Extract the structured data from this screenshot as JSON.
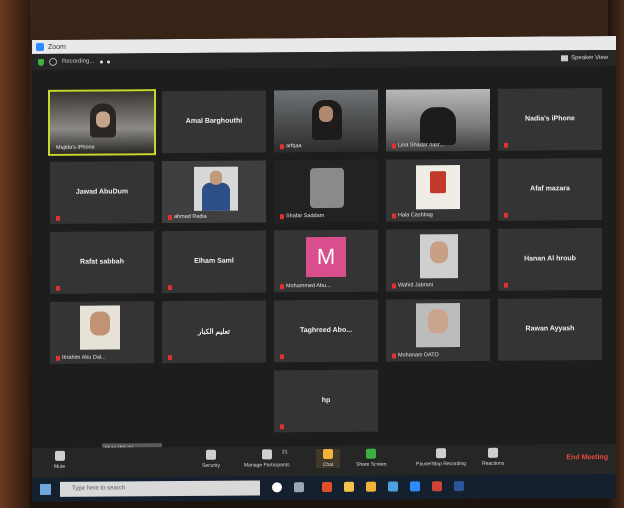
{
  "window": {
    "title": "Zoom"
  },
  "topbar": {
    "recording_label": "Recording...",
    "view_label": "Speaker View"
  },
  "participants": [
    {
      "name": "Majida's iPhone",
      "display": "video"
    },
    {
      "name": "Amal Barghouthi",
      "display": "name"
    },
    {
      "name": "arfqaa",
      "display": "video"
    },
    {
      "name": "Lina Shadar nasr...",
      "display": "video"
    },
    {
      "name": "Nadia's iPhone",
      "display": "name"
    },
    {
      "name": "Jawad AbuDum",
      "display": "name"
    },
    {
      "name": "ahmad Radia",
      "display": "video"
    },
    {
      "name": "Shafar Saddam",
      "display": "video"
    },
    {
      "name": "Hala Cashbag",
      "display": "video"
    },
    {
      "name": "Afaf mazara",
      "display": "name"
    },
    {
      "name": "Rafat sabbah",
      "display": "name"
    },
    {
      "name": "Elham Saml",
      "display": "name"
    },
    {
      "name": "Mohammed Abu...",
      "display": "avatar",
      "avatar_letter": "M"
    },
    {
      "name": "Wahid Jabrani",
      "display": "video"
    },
    {
      "name": "Hanan Al hroub",
      "display": "name"
    },
    {
      "name": "Ibrahim Abu Dal...",
      "display": "video"
    },
    {
      "name": "تعليم الكبار",
      "display": "name"
    },
    {
      "name": "Taghreed Abo...",
      "display": "name"
    },
    {
      "name": "Mohanam DATO",
      "display": "video"
    },
    {
      "name": "Rawan Ayyash",
      "display": "name"
    },
    {
      "name": "hp",
      "display": "name"
    }
  ],
  "toolbar": {
    "mute": "Mute",
    "security": "Security",
    "manage_participants": "Manage Participants",
    "participants_count": "21",
    "chat": "Chat",
    "share_screen": "Share Screen",
    "pause_share": "Pause/Stop Recording",
    "reactions": "Reactions",
    "end_meeting": "End Meeting",
    "mic_tooltip": "Mute (Alt+A)"
  },
  "taskbar": {
    "search_placeholder": "Type here to search"
  },
  "colors": {
    "accent_active_speaker": "#c8d82a",
    "avatar_pink": "#d94f8e",
    "end_meeting": "#e74c3c"
  }
}
